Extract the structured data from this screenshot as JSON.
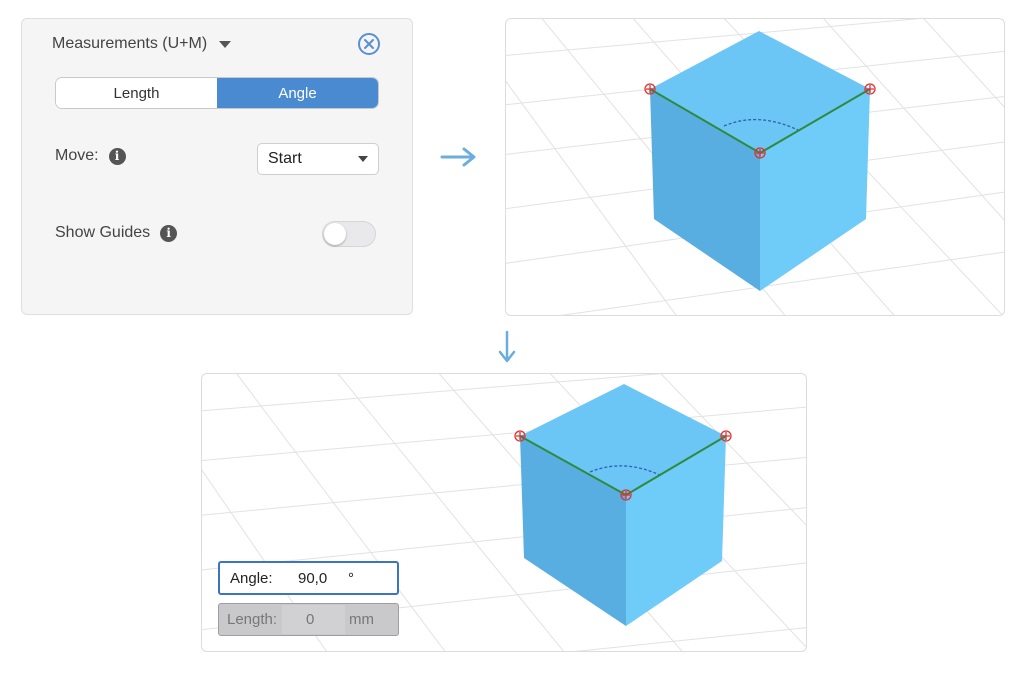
{
  "panel": {
    "title": "Measurements (U+M)",
    "tabs": [
      {
        "label": "Length",
        "active": false
      },
      {
        "label": "Angle",
        "active": true
      }
    ],
    "move_label": "Move:",
    "move_select_value": "Start",
    "show_guides_label": "Show Guides",
    "show_guides_on": false,
    "info_glyph": "i"
  },
  "viewport_bottom": {
    "angle_label": "Angle:",
    "angle_value": "90,0",
    "angle_unit": "°",
    "length_label": "Length:",
    "length_value": "0",
    "length_unit": "mm"
  },
  "colors": {
    "accent": "#4a8ad0",
    "cube_top": "#6cc6f5",
    "cube_left": "#58aee0",
    "cube_right": "#6fcbf8",
    "measure_line": "#2e8b3e",
    "marker": "#e03030",
    "arrow": "#6aaee0"
  },
  "icons": [
    "chevron-down-icon",
    "close-icon",
    "info-icon",
    "arrow-right-icon",
    "arrow-down-icon"
  ]
}
